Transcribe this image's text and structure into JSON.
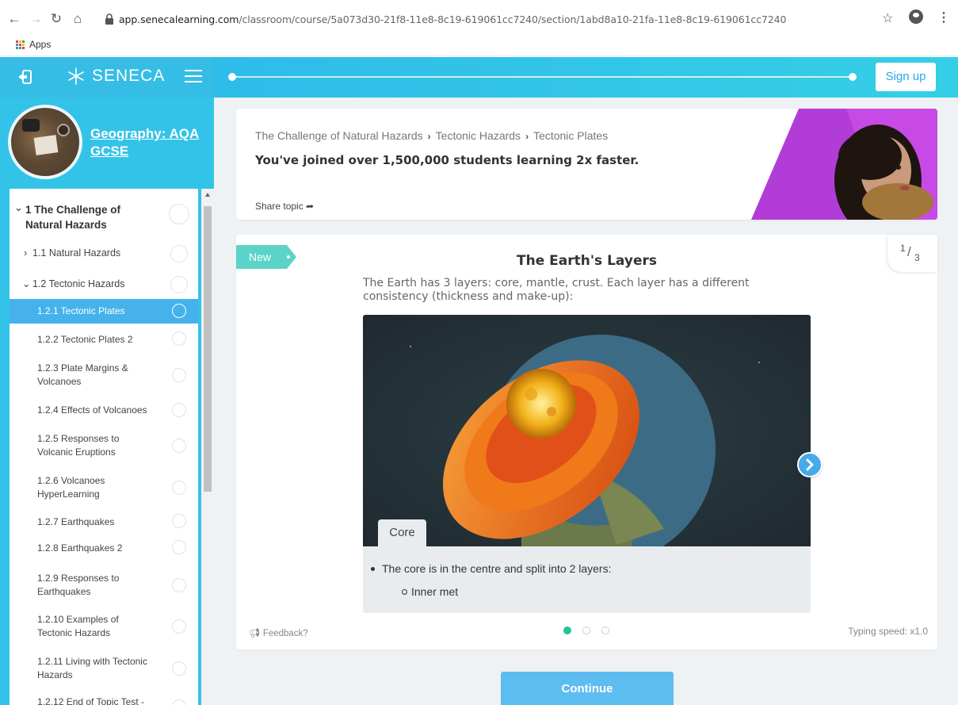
{
  "browser": {
    "url_host": "app.senecalearning.com",
    "url_path": "/classroom/course/5a073d30-21f8-11e8-8c19-619061cc7240/section/1abd8a10-21fa-11e8-8c19-619061cc7240",
    "bookmarks_label": "Apps"
  },
  "header": {
    "brand": "SENECA",
    "signup_label": "Sign up",
    "progress": 0.0
  },
  "sidebar": {
    "course_title": "Geography: AQA GCSE",
    "items": [
      {
        "label": "1 The Challenge of Natural Hazards",
        "level": 0,
        "expanded": true
      },
      {
        "label": "1.1 Natural Hazards",
        "level": 1,
        "expanded": false
      },
      {
        "label": "1.2 Tectonic Hazards",
        "level": 1,
        "expanded": true
      },
      {
        "label": "1.2.1 Tectonic Plates",
        "level": 2,
        "active": true
      },
      {
        "label": "1.2.2 Tectonic Plates 2",
        "level": 2
      },
      {
        "label": "1.2.3 Plate Margins & Volcanoes",
        "level": 2
      },
      {
        "label": "1.2.4 Effects of Volcanoes",
        "level": 2
      },
      {
        "label": "1.2.5 Responses to Volcanic Eruptions",
        "level": 2
      },
      {
        "label": "1.2.6 Volcanoes HyperLearning",
        "level": 2
      },
      {
        "label": "1.2.7 Earthquakes",
        "level": 2
      },
      {
        "label": "1.2.8 Earthquakes 2",
        "level": 2
      },
      {
        "label": "1.2.9 Responses to Earthquakes",
        "level": 2
      },
      {
        "label": "1.2.10 Examples of Tectonic Hazards",
        "level": 2
      },
      {
        "label": "1.2.11 Living with Tectonic Hazards",
        "level": 2
      },
      {
        "label": "1.2.12 End of Topic Test -",
        "level": 2
      }
    ]
  },
  "topic": {
    "breadcrumb": [
      "The Challenge of Natural Hazards",
      "Tectonic Hazards",
      "Tectonic Plates"
    ],
    "joined_text": "You've joined over 1,500,000 students learning 2x faster.",
    "share_label": "Share topic"
  },
  "lesson": {
    "tag": "New",
    "counter_current": "1",
    "counter_total": "3",
    "title": "The Earth's Layers",
    "description": "The Earth has 3 layers: core, mantle, crust. Each layer has a different consistency (thickness and make-up):",
    "image_tab": "Core",
    "notes": [
      "The core is in the centre and split into 2 layers:",
      "Inner met"
    ],
    "feedback_label": "Feedback?",
    "typing_speed": "Typing speed: x1.0",
    "dots_active": 0,
    "dots_total": 3
  },
  "continue_label": "Continue",
  "colors": {
    "accent": "#34c3e8",
    "active_item": "#45b2ec",
    "new_tag": "#5cd3c8",
    "dot_active": "#22c29a",
    "continue": "#5dbcf0"
  }
}
